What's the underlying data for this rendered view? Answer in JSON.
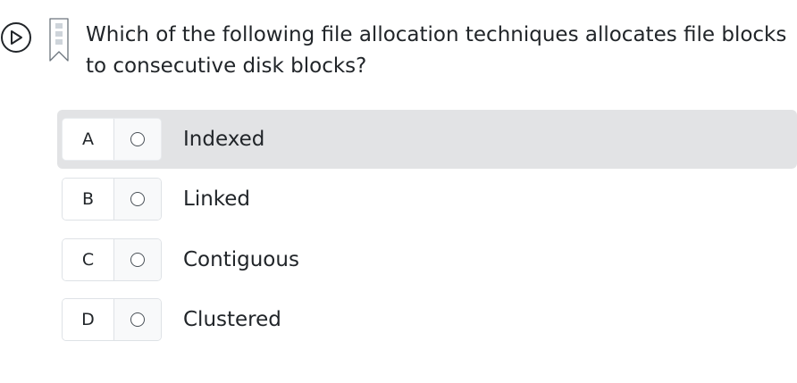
{
  "question": {
    "text": "Which of the following file allocation techniques allocates file blocks to consecutive disk blocks?"
  },
  "icons": {
    "play": "play-circle-icon",
    "bookmark": "bookmark-icon"
  },
  "options": [
    {
      "letter": "A",
      "label": "Indexed",
      "highlighted": true
    },
    {
      "letter": "B",
      "label": "Linked",
      "highlighted": false
    },
    {
      "letter": "C",
      "label": "Contiguous",
      "highlighted": false
    },
    {
      "letter": "D",
      "label": "Clustered",
      "highlighted": false
    }
  ],
  "colors": {
    "highlight": "#e2e3e5",
    "border": "#dee2e6",
    "text": "#212529"
  }
}
